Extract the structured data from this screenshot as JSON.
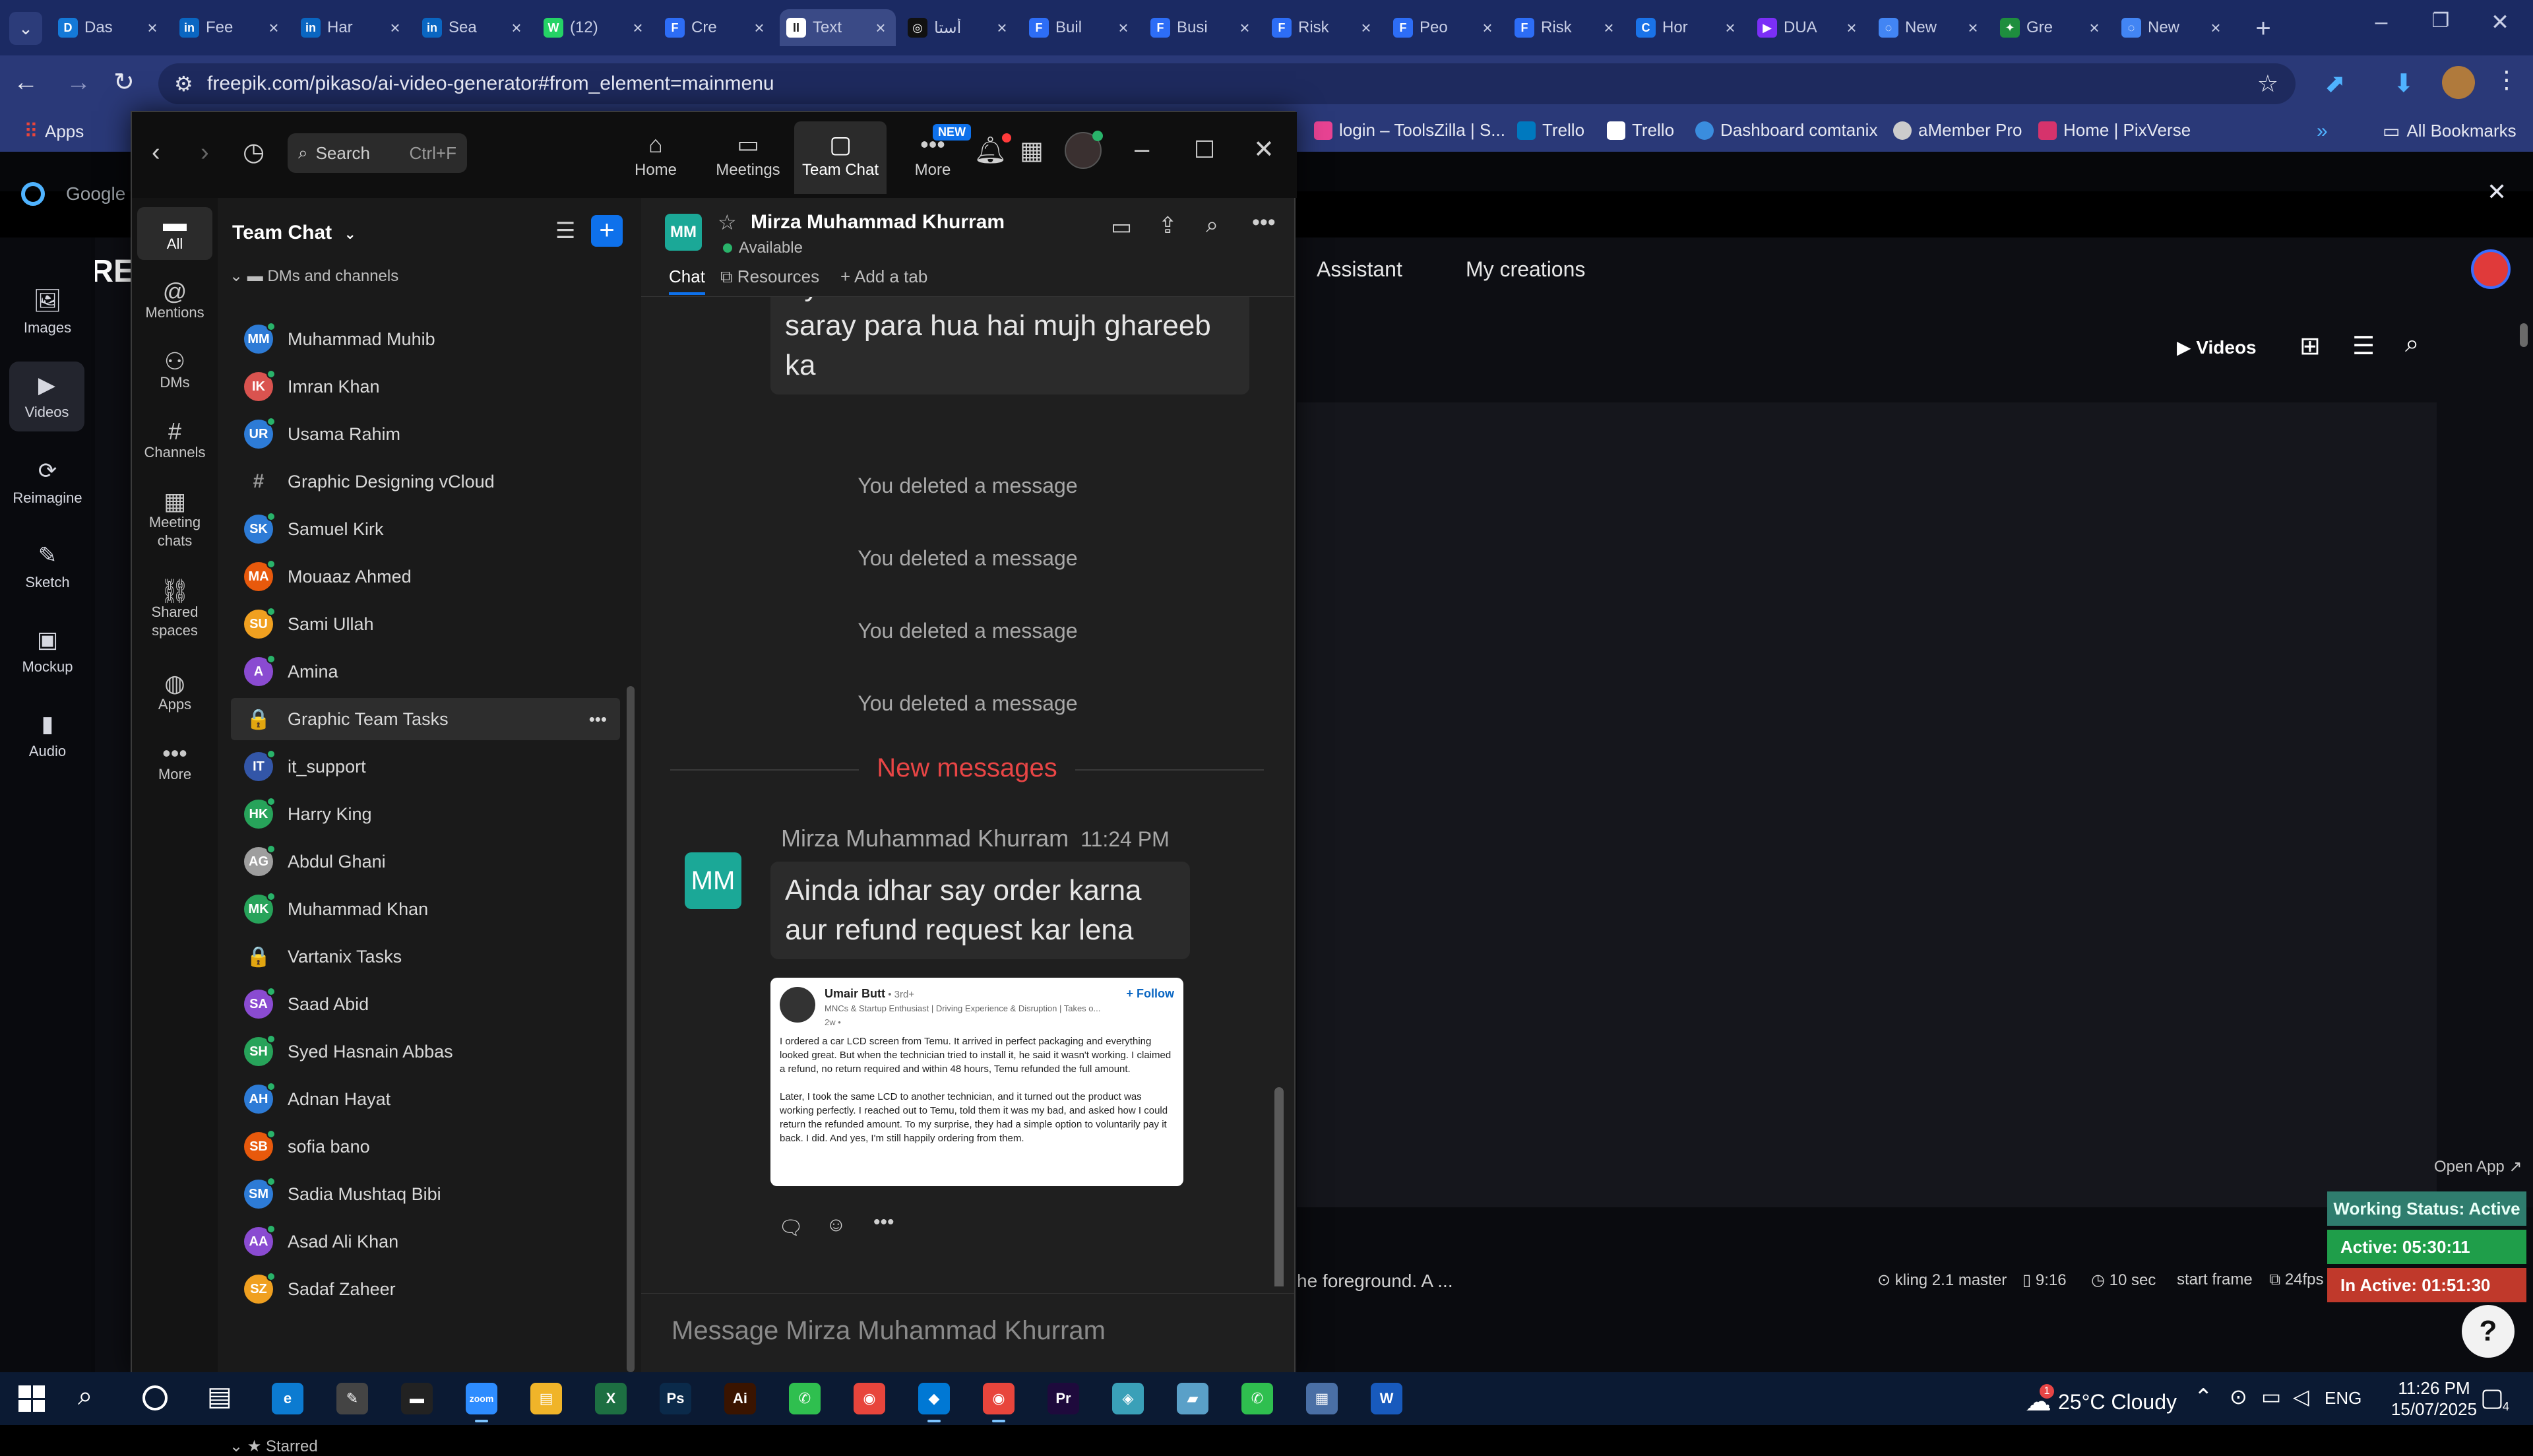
{
  "browser": {
    "tabs": [
      {
        "label": "Das",
        "color": "#1479d8",
        "glyph": "D"
      },
      {
        "label": "Fee",
        "color": "#0a66c2",
        "glyph": "in"
      },
      {
        "label": "Har",
        "color": "#0a66c2",
        "glyph": "in"
      },
      {
        "label": "Sea",
        "color": "#0a66c2",
        "glyph": "in"
      },
      {
        "label": "(12)",
        "color": "#25d366",
        "glyph": "W"
      },
      {
        "label": "Cre",
        "color": "#2d6df6",
        "glyph": "F"
      },
      {
        "label": "Text",
        "color": "#ffffff",
        "glyph": "II"
      },
      {
        "label": "أستا",
        "color": "#111111",
        "glyph": "◎"
      },
      {
        "label": "Buil",
        "color": "#2d6df6",
        "glyph": "F"
      },
      {
        "label": "Busi",
        "color": "#2d6df6",
        "glyph": "F"
      },
      {
        "label": "Risk",
        "color": "#2d6df6",
        "glyph": "F"
      },
      {
        "label": "Peo",
        "color": "#2d6df6",
        "glyph": "F"
      },
      {
        "label": "Risk",
        "color": "#2d6df6",
        "glyph": "F"
      },
      {
        "label": "Hor",
        "color": "#1a73e8",
        "glyph": "C"
      },
      {
        "label": "DUA",
        "color": "#7b2ff7",
        "glyph": "▶"
      },
      {
        "label": "New",
        "color": "#4285f4",
        "glyph": "◌"
      },
      {
        "label": "Gre",
        "color": "#1e8e3e",
        "glyph": "✦"
      },
      {
        "label": "New",
        "color": "#4285f4",
        "glyph": "◌"
      }
    ],
    "active_tab_index": 6,
    "url": "freepik.com/pikaso/ai-video-generator#from_element=mainmenu",
    "bookmarks": [
      {
        "label": "Apps",
        "color": "#e8453c"
      },
      {
        "label": "login – ToolsZilla | S...",
        "color": "#e84393"
      },
      {
        "label": "Trello",
        "color": "#0079bf"
      },
      {
        "label": "Trello",
        "color": "#ffffff"
      },
      {
        "label": "Dashboard comtanix",
        "color": "#3a8dde"
      },
      {
        "label": "aMember Pro",
        "color": "#cccccc"
      },
      {
        "label": "Home | PixVerse",
        "color": "#d6336c"
      }
    ],
    "all_bookmarks": "All Bookmarks"
  },
  "site": {
    "google_label": "Google",
    "logo": "FRE",
    "nav": [
      "Assistant",
      "My creations"
    ],
    "left_nav": [
      {
        "label": "Images",
        "icon": "🖼"
      },
      {
        "label": "Videos",
        "icon": "▶"
      },
      {
        "label": "Reimagine",
        "icon": "⟳"
      },
      {
        "label": "Sketch",
        "icon": "✎"
      },
      {
        "label": "Mockup",
        "icon": "▣"
      },
      {
        "label": "Audio",
        "icon": "▮"
      }
    ],
    "videos_filter": "Videos",
    "open_app": "Open App ↗",
    "prompt_fragment": "he foreground. A ...",
    "options": [
      "kling 2.1 master",
      "9:16",
      "10 sec",
      "start frame",
      "24fps"
    ],
    "status": {
      "working": "Working Status: Active",
      "active": "Active: 05:30:11",
      "inactive": "In Active: 01:51:30"
    },
    "help": "?"
  },
  "teams": {
    "search_placeholder": "Search",
    "search_shortcut": "Ctrl+F",
    "top_nav": [
      {
        "label": "Home",
        "icon": "⌂"
      },
      {
        "label": "Meetings",
        "icon": "▭"
      },
      {
        "label": "Team Chat",
        "icon": "▢"
      },
      {
        "label": "More",
        "icon": "•••",
        "badge": "NEW"
      }
    ],
    "rail": [
      {
        "label": "All",
        "icon": "▬"
      },
      {
        "label": "Mentions",
        "icon": "@"
      },
      {
        "label": "DMs",
        "icon": "⚇"
      },
      {
        "label": "Channels",
        "icon": "#"
      },
      {
        "label": "Meeting chats",
        "icon": "▦"
      },
      {
        "label": "Shared spaces",
        "icon": "⛓"
      },
      {
        "label": "Apps",
        "icon": "◍"
      },
      {
        "label": "More",
        "icon": "•••"
      }
    ],
    "list_title": "Team Chat",
    "section": "DMs and channels",
    "contacts": [
      {
        "name": "Muhammad Muhib",
        "initials": "MM",
        "color": "#2d7bd6"
      },
      {
        "name": "Imran Khan",
        "initials": "IK",
        "color": "#d9534f"
      },
      {
        "name": "Usama Rahim",
        "initials": "UR",
        "color": "#2d7bd6"
      },
      {
        "name": "Graphic Designing vCloud",
        "initials": "#",
        "color": "channel"
      },
      {
        "name": "Samuel Kirk",
        "initials": "SK",
        "color": "#2d7bd6"
      },
      {
        "name": "Mouaaz Ahmed",
        "initials": "MA",
        "color": "#e8590c"
      },
      {
        "name": "Sami Ullah",
        "initials": "SU",
        "color": "#f0a020"
      },
      {
        "name": "Amina",
        "initials": "A",
        "color": "#8a4bd1"
      },
      {
        "name": "Graphic Team Tasks",
        "initials": "🔒",
        "color": "channel"
      },
      {
        "name": "it_support",
        "initials": "IT",
        "color": "#3356a8"
      },
      {
        "name": "Harry King",
        "initials": "HK",
        "color": "#27a35a"
      },
      {
        "name": "Abdul Ghani",
        "initials": "AG",
        "color": "#9e9e9e"
      },
      {
        "name": "Muhammad Khan",
        "initials": "MK",
        "color": "#27a35a"
      },
      {
        "name": "Vartanix Tasks",
        "initials": "🔒",
        "color": "channel"
      },
      {
        "name": "Saad Abid",
        "initials": "SA",
        "color": "#8a4bd1"
      },
      {
        "name": "Syed Hasnain Abbas",
        "initials": "SH",
        "color": "#27a35a"
      },
      {
        "name": "Adnan Hayat",
        "initials": "AH",
        "color": "#2d7bd6"
      },
      {
        "name": "sofia bano",
        "initials": "SB",
        "color": "#e8590c"
      },
      {
        "name": "Sadia Mushtaq Bibi",
        "initials": "SM",
        "color": "#2d7bd6"
      },
      {
        "name": "Asad Ali Khan",
        "initials": "AA",
        "color": "#8a4bd1"
      },
      {
        "name": "Sadaf Zaheer",
        "initials": "SZ",
        "color": "#f0a020"
      }
    ],
    "starred": "Starred",
    "chat": {
      "title": "Mirza Muhammad Khurram",
      "initials": "MM",
      "status": "Available",
      "tabs": [
        "Chat",
        "Resources",
        "+ Add a tab"
      ],
      "previous_message": "Kya kar sakta hoon kaam bohot saray para hua hai mujh ghareeb ka",
      "deleted": [
        "You deleted a message",
        "You deleted a message",
        "You deleted a message",
        "You deleted a message"
      ],
      "new_messages": "New messages",
      "sender": "Mirza Muhammad Khurram",
      "time": "11:24 PM",
      "message": "Ainda idhar say order karna aur refund request kar lena",
      "post": {
        "author": "Umair Butt",
        "degree": "• 3rd+",
        "headline": "MNCs & Startup Enthusiast | Driving Experience & Disruption | Takes o...",
        "age": "2w •",
        "follow": "+ Follow",
        "body1": "I ordered a car LCD screen from Temu. It arrived in perfect packaging and everything looked great. But when the technician tried to install it, he said it wasn't working. I claimed a refund, no return required and within 48 hours, Temu refunded the full amount.",
        "body2": "Later, I took the same LCD to another technician, and it turned out the product was working perfectly. I reached out to Temu, told them it was my bad, and asked how I could return the refunded amount. To my surprise, they had a simple option to voluntarily pay it back. I did. And yes, I'm still happily ordering from them."
      },
      "composer_placeholder": "Message Mirza Muhammad Khurram"
    }
  },
  "taskbar": {
    "weather": "25°C Cloudy",
    "weather_badge": "1",
    "lang": "ENG",
    "time": "11:26 PM",
    "date": "15/07/2025",
    "notif_badge": "4",
    "apps": [
      {
        "label": "e",
        "color": "#0c7bd1"
      },
      {
        "label": "✎",
        "color": "#444444"
      },
      {
        "label": "▬",
        "color": "#222222"
      },
      {
        "label": "zoom",
        "color": "#2d8cff"
      },
      {
        "label": "▤",
        "color": "#f0b429"
      },
      {
        "label": "X",
        "color": "#1d6f42"
      },
      {
        "label": "Ps",
        "color": "#0b2a4a"
      },
      {
        "label": "Ai",
        "color": "#3a1400"
      },
      {
        "label": "✆",
        "color": "#2fbf4f"
      },
      {
        "label": "◉",
        "color": "#e8453c"
      },
      {
        "label": "◆",
        "color": "#0078d4"
      },
      {
        "label": "◉",
        "color": "#e8453c"
      },
      {
        "label": "Pr",
        "color": "#1e0a3c"
      },
      {
        "label": "◈",
        "color": "#3aa0b8"
      },
      {
        "label": "▰",
        "color": "#5aa0c8"
      },
      {
        "label": "✆",
        "color": "#2fbf4f"
      },
      {
        "label": "▦",
        "color": "#4a6fa5"
      },
      {
        "label": "W",
        "color": "#185abd"
      }
    ]
  }
}
